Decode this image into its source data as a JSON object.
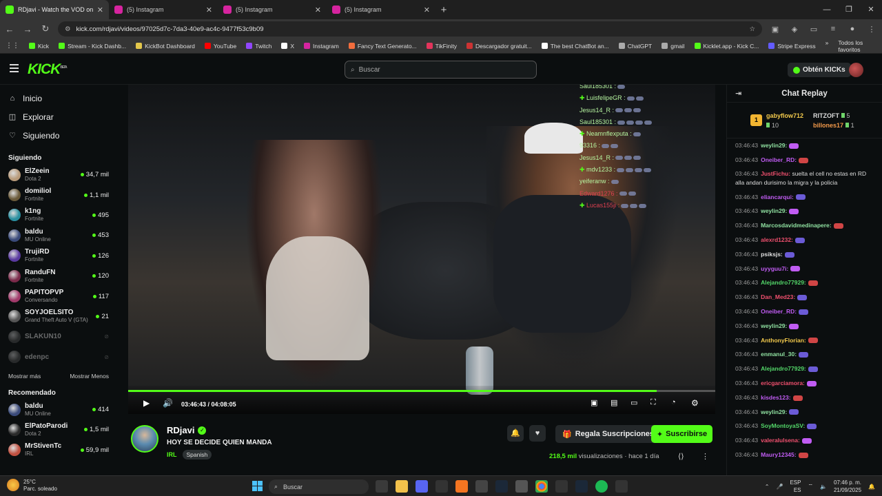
{
  "browser": {
    "tabs": [
      {
        "title": "RDjavi - Watch the VOD on Kick",
        "favicon_color": "#53fc18",
        "active": true
      },
      {
        "title": "(5) Instagram",
        "favicon_color": "#d6249f",
        "active": false
      },
      {
        "title": "(5) Instagram",
        "favicon_color": "#d6249f",
        "active": false
      },
      {
        "title": "(5) Instagram",
        "favicon_color": "#d6249f",
        "active": false
      }
    ],
    "url": "kick.com/rdjavi/videos/97025d7c-7da3-40e9-ac4c-9477f53c9b09",
    "bookmarks": [
      {
        "label": "Kick",
        "color": "#53fc18"
      },
      {
        "label": "Stream - Kick Dashb...",
        "color": "#53fc18"
      },
      {
        "label": "KickBot Dashboard",
        "color": "#e3c74b"
      },
      {
        "label": "YouTube",
        "color": "#ff0000"
      },
      {
        "label": "Twitch",
        "color": "#9146ff"
      },
      {
        "label": "X",
        "color": "#ffffff"
      },
      {
        "label": "Instagram",
        "color": "#d6249f"
      },
      {
        "label": "Fancy Text Generato...",
        "color": "#f26d3d"
      },
      {
        "label": "TikFinity",
        "color": "#e3345c"
      },
      {
        "label": "Descargador gratuit...",
        "color": "#c33"
      },
      {
        "label": "The best ChatBot an...",
        "color": "#fff"
      },
      {
        "label": "ChatGPT",
        "color": "#aaa"
      },
      {
        "label": "gmail",
        "color": "#aaa"
      },
      {
        "label": "Kicklet.app - Kick C...",
        "color": "#53fc18"
      },
      {
        "label": "Stripe Express",
        "color": "#635bff"
      }
    ],
    "bookmarks_all": "Todos los favoritos"
  },
  "header": {
    "logo": "KICK",
    "logo_tag": "BETA",
    "search_placeholder": "Buscar",
    "get_kicks": "Obtén KICKs"
  },
  "sidebar": {
    "nav": [
      {
        "label": "Inicio",
        "icon": "home-icon"
      },
      {
        "label": "Explorar",
        "icon": "compass-icon"
      },
      {
        "label": "Siguiendo",
        "icon": "heart-icon"
      }
    ],
    "following_title": "Siguiendo",
    "following": [
      {
        "name": "ElZeein",
        "game": "Dota 2",
        "viewers": "34,7 mil",
        "color": "#b89a7a",
        "online": true
      },
      {
        "name": "domiliol",
        "game": "Fortnite",
        "viewers": "1,1 mil",
        "color": "#6a5a3a",
        "online": true
      },
      {
        "name": "k1ng",
        "game": "Fortnite",
        "viewers": "495",
        "color": "#2a8fa0",
        "online": true
      },
      {
        "name": "baldu",
        "game": "MU Online",
        "viewers": "453",
        "color": "#3a4a7a",
        "online": true
      },
      {
        "name": "TrujiRD",
        "game": "Fortnite",
        "viewers": "126",
        "color": "#5a3aa0",
        "online": true
      },
      {
        "name": "RanduFN",
        "game": "Fortnite",
        "viewers": "120",
        "color": "#7a2a4a",
        "online": true
      },
      {
        "name": "PAPITOPVP",
        "game": "Conversando",
        "viewers": "117",
        "color": "#a03a6a",
        "online": true
      },
      {
        "name": "SOYJOELSITO",
        "game": "Grand Theft Auto V (GTA)",
        "viewers": "21",
        "color": "#555",
        "online": true
      },
      {
        "name": "SLAKUN10",
        "game": "",
        "viewers": "",
        "color": "#555",
        "online": false
      },
      {
        "name": "edenpc",
        "game": "",
        "viewers": "",
        "color": "#555",
        "online": false
      }
    ],
    "show_more": "Mostrar más",
    "show_less": "Mostrar Menos",
    "recommended_title": "Recomendado",
    "recommended": [
      {
        "name": "baldu",
        "game": "MU Online",
        "viewers": "414",
        "color": "#3a4a7a"
      },
      {
        "name": "ElPatoParodi",
        "game": "Dota 2",
        "viewers": "1,5 mil",
        "color": "#2a2a2a"
      },
      {
        "name": "MrStivenTc",
        "game": "IRL",
        "viewers": "59,9 mil",
        "color": "#c05040"
      }
    ]
  },
  "video": {
    "overlay_chat": [
      "Saul185301 :",
      "LuisfelipeGR :",
      "Jesus14_R :",
      "Saul185301 :",
      "Neamnflexputa :",
      "93316 :",
      "Jesus14_R :",
      "mdv1233 :",
      "yeiferanw :",
      "Edward1276 :",
      "Lucas155ji :"
    ],
    "progress": 0.9,
    "current_time": "03:46:43",
    "duration": "04:08:05"
  },
  "stream": {
    "name": "RDjavi",
    "title": "HOY SE DECIDE QUIEN MANDA",
    "category": "IRL",
    "tag": "Spanish",
    "gift_label": "Regala Suscripciones",
    "subscribe_label": "Suscribirse",
    "views_count": "218,5 mil",
    "views_label": "visualizaciones",
    "age": "hace 1 día"
  },
  "chat": {
    "title": "Chat Replay",
    "leaderboard": {
      "rank": "1",
      "first_user": "gabyflow712",
      "first_count": "10",
      "second_user": "RITZOFT",
      "second_count": "5",
      "third_user": "billones17",
      "third_count": "1"
    },
    "messages": [
      {
        "time": "03:46:43",
        "user": "weylin29:",
        "color": "#8fe0a0",
        "text": "",
        "emote": true
      },
      {
        "time": "03:46:43",
        "user": "Oneiber_RD:",
        "color": "#c05cf2",
        "text": "",
        "emote": true
      },
      {
        "time": "03:46:43",
        "user": "JustFichu:",
        "color": "#f0506e",
        "text": "suelta el cell no estas en RD alla andan durisimo la migra y la policia",
        "emote": false
      },
      {
        "time": "03:46:43",
        "user": "eliancarqui:",
        "color": "#c05cf2",
        "text": "",
        "emote": true
      },
      {
        "time": "03:46:43",
        "user": "weylin29:",
        "color": "#8fe0a0",
        "text": "",
        "emote": true
      },
      {
        "time": "03:46:43",
        "user": "Marcosdavidmedinapere:",
        "color": "#8fe0a0",
        "text": "",
        "emote": true
      },
      {
        "time": "03:46:43",
        "user": "alexrd1232:",
        "color": "#f0506e",
        "text": "",
        "emote": true
      },
      {
        "time": "03:46:43",
        "user": "psiksjs:",
        "color": "#e0e0e0",
        "text": "",
        "emote": true
      },
      {
        "time": "03:46:43",
        "user": "uyyguu7i:",
        "color": "#c05cf2",
        "text": "",
        "emote": true
      },
      {
        "time": "03:46:43",
        "user": "Alejandro77929:",
        "color": "#53d769",
        "text": "",
        "emote": true
      },
      {
        "time": "03:46:43",
        "user": "Dan_Med23:",
        "color": "#f0506e",
        "text": "",
        "emote": true
      },
      {
        "time": "03:46:43",
        "user": "Oneiber_RD:",
        "color": "#c05cf2",
        "text": "",
        "emote": true
      },
      {
        "time": "03:46:43",
        "user": "weylin29:",
        "color": "#8fe0a0",
        "text": "",
        "emote": true
      },
      {
        "time": "03:46:43",
        "user": "AnthonyFlorian:",
        "color": "#f2c94c",
        "text": "",
        "emote": true
      },
      {
        "time": "03:46:43",
        "user": "enmanul_30:",
        "color": "#8fe0a0",
        "text": "",
        "emote": true
      },
      {
        "time": "03:46:43",
        "user": "Alejandro77929:",
        "color": "#53d769",
        "text": "",
        "emote": true
      },
      {
        "time": "03:46:43",
        "user": "ericgarciamora:",
        "color": "#f0506e",
        "text": "",
        "emote": true
      },
      {
        "time": "03:46:43",
        "user": "kisdes123:",
        "color": "#c05cf2",
        "text": "",
        "emote": true
      },
      {
        "time": "03:46:43",
        "user": "weylin29:",
        "color": "#8fe0a0",
        "text": "",
        "emote": true
      },
      {
        "time": "03:46:43",
        "user": "SoyMontoyaSV:",
        "color": "#53d769",
        "text": "",
        "emote": true
      },
      {
        "time": "03:46:43",
        "user": "valeralulsena:",
        "color": "#f0506e",
        "text": "",
        "emote": true
      },
      {
        "time": "03:46:43",
        "user": "Maury12345:",
        "color": "#c05cf2",
        "text": "",
        "emote": true
      }
    ]
  },
  "taskbar": {
    "temp": "25°C",
    "weather": "Parc. soleado",
    "search": "Buscar",
    "lang1": "ESP",
    "lang2": "ES",
    "time": "07:46 p. m.",
    "date": "21/09/2025"
  },
  "colors": {
    "accent": "#53fc18",
    "bg": "#0b0e0f"
  }
}
